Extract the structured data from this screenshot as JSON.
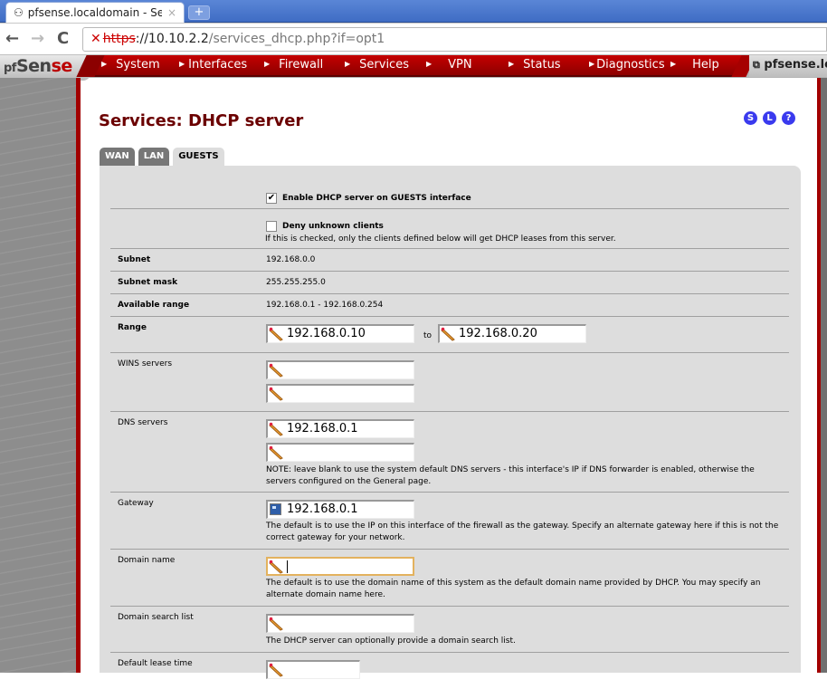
{
  "browser": {
    "tab_title": "pfsense.localdomain - Servi...",
    "tab_close": "×",
    "new_tab": "+",
    "url_protocol": "https",
    "url_host": "://10.10.2.2",
    "url_path": "/services_dhcp.php?if=opt1",
    "icons": {
      "back": "←",
      "forward": "→",
      "reload": "C",
      "insecure": "✕"
    }
  },
  "header": {
    "logo_part1": "Sen",
    "logo_part2": "se",
    "logo_prefix": "pf",
    "menu": [
      {
        "label": "System"
      },
      {
        "label": "Interfaces"
      },
      {
        "label": "Firewall"
      },
      {
        "label": "Services"
      },
      {
        "label": "VPN"
      },
      {
        "label": "Status"
      },
      {
        "label": "Diagnostics"
      },
      {
        "label": "Help"
      }
    ],
    "hostname": "pfsense.localdomain"
  },
  "page": {
    "title": "Services: DHCP server",
    "help_icons": [
      "S",
      "L",
      "?"
    ],
    "tabs": [
      {
        "label": "WAN",
        "active": false
      },
      {
        "label": "LAN",
        "active": false
      },
      {
        "label": "GUESTS",
        "active": true
      }
    ]
  },
  "form": {
    "enable": {
      "checked": true,
      "mark": "✔",
      "label": "Enable DHCP server on GUESTS interface"
    },
    "deny": {
      "checked": false,
      "label": "Deny unknown clients",
      "desc": "If this is checked, only the clients defined below will get DHCP leases from this server."
    },
    "subnet": {
      "label": "Subnet",
      "value": "192.168.0.0"
    },
    "subnet_mask": {
      "label": "Subnet mask",
      "value": "255.255.255.0"
    },
    "available_range": {
      "label": "Available range",
      "value": "192.168.0.1 - 192.168.0.254"
    },
    "range": {
      "label": "Range",
      "from": "192.168.0.10",
      "to_label": "to",
      "to": "192.168.0.20"
    },
    "wins": {
      "label": "WINS servers",
      "values": [
        "",
        ""
      ]
    },
    "dns": {
      "label": "DNS servers",
      "values": [
        "192.168.0.1",
        ""
      ],
      "note": "NOTE: leave blank to use the system default DNS servers - this interface's IP if DNS forwarder is enabled, otherwise the servers configured on the General page."
    },
    "gateway": {
      "label": "Gateway",
      "value": "192.168.0.1",
      "desc": "The default is to use the IP on this interface of the firewall as the gateway. Specify an alternate gateway here if this is not the correct gateway for your network."
    },
    "domain_name": {
      "label": "Domain name",
      "value": "",
      "desc": "The default is to use the domain name of this system as the default domain name provided by DHCP. You may specify an alternate domain name here."
    },
    "domain_search": {
      "label": "Domain search list",
      "value": "",
      "desc": "The DHCP server can optionally provide a domain search list."
    },
    "default_lease": {
      "label": "Default lease time",
      "value": ""
    }
  }
}
